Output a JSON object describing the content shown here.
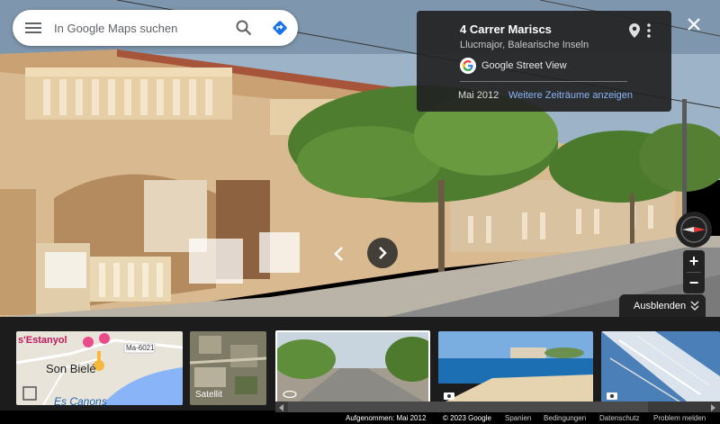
{
  "search": {
    "placeholder": "In Google Maps suchen",
    "menu_icon": "hamburger-menu-icon",
    "search_icon": "search-icon",
    "directions_icon": "directions-icon",
    "directions_color": "#1a73e8"
  },
  "info_card": {
    "address": "4 Carrer Mariscs",
    "region": "Llucmajor, Balearische Inseln",
    "source": "Google Street View",
    "date": "Mai 2012",
    "more_link": "Weitere Zeiträume anzeigen",
    "link_color": "#8ab4f8"
  },
  "controls": {
    "hide_label": "Ausblenden",
    "zoom_in": "+",
    "zoom_out": "−"
  },
  "filmstrip": {
    "map": {
      "labels": [
        "s'Estanyol",
        "Son Bielé",
        "Es Canons"
      ],
      "road": "Ma-6021"
    },
    "satellite_label": "Satellit"
  },
  "footer": {
    "captured": "Aufgenommen: Mai 2012",
    "copyright": "© 2023 Google",
    "links": [
      "Spanien",
      "Bedingungen",
      "Datenschutz",
      "Problem melden"
    ]
  }
}
